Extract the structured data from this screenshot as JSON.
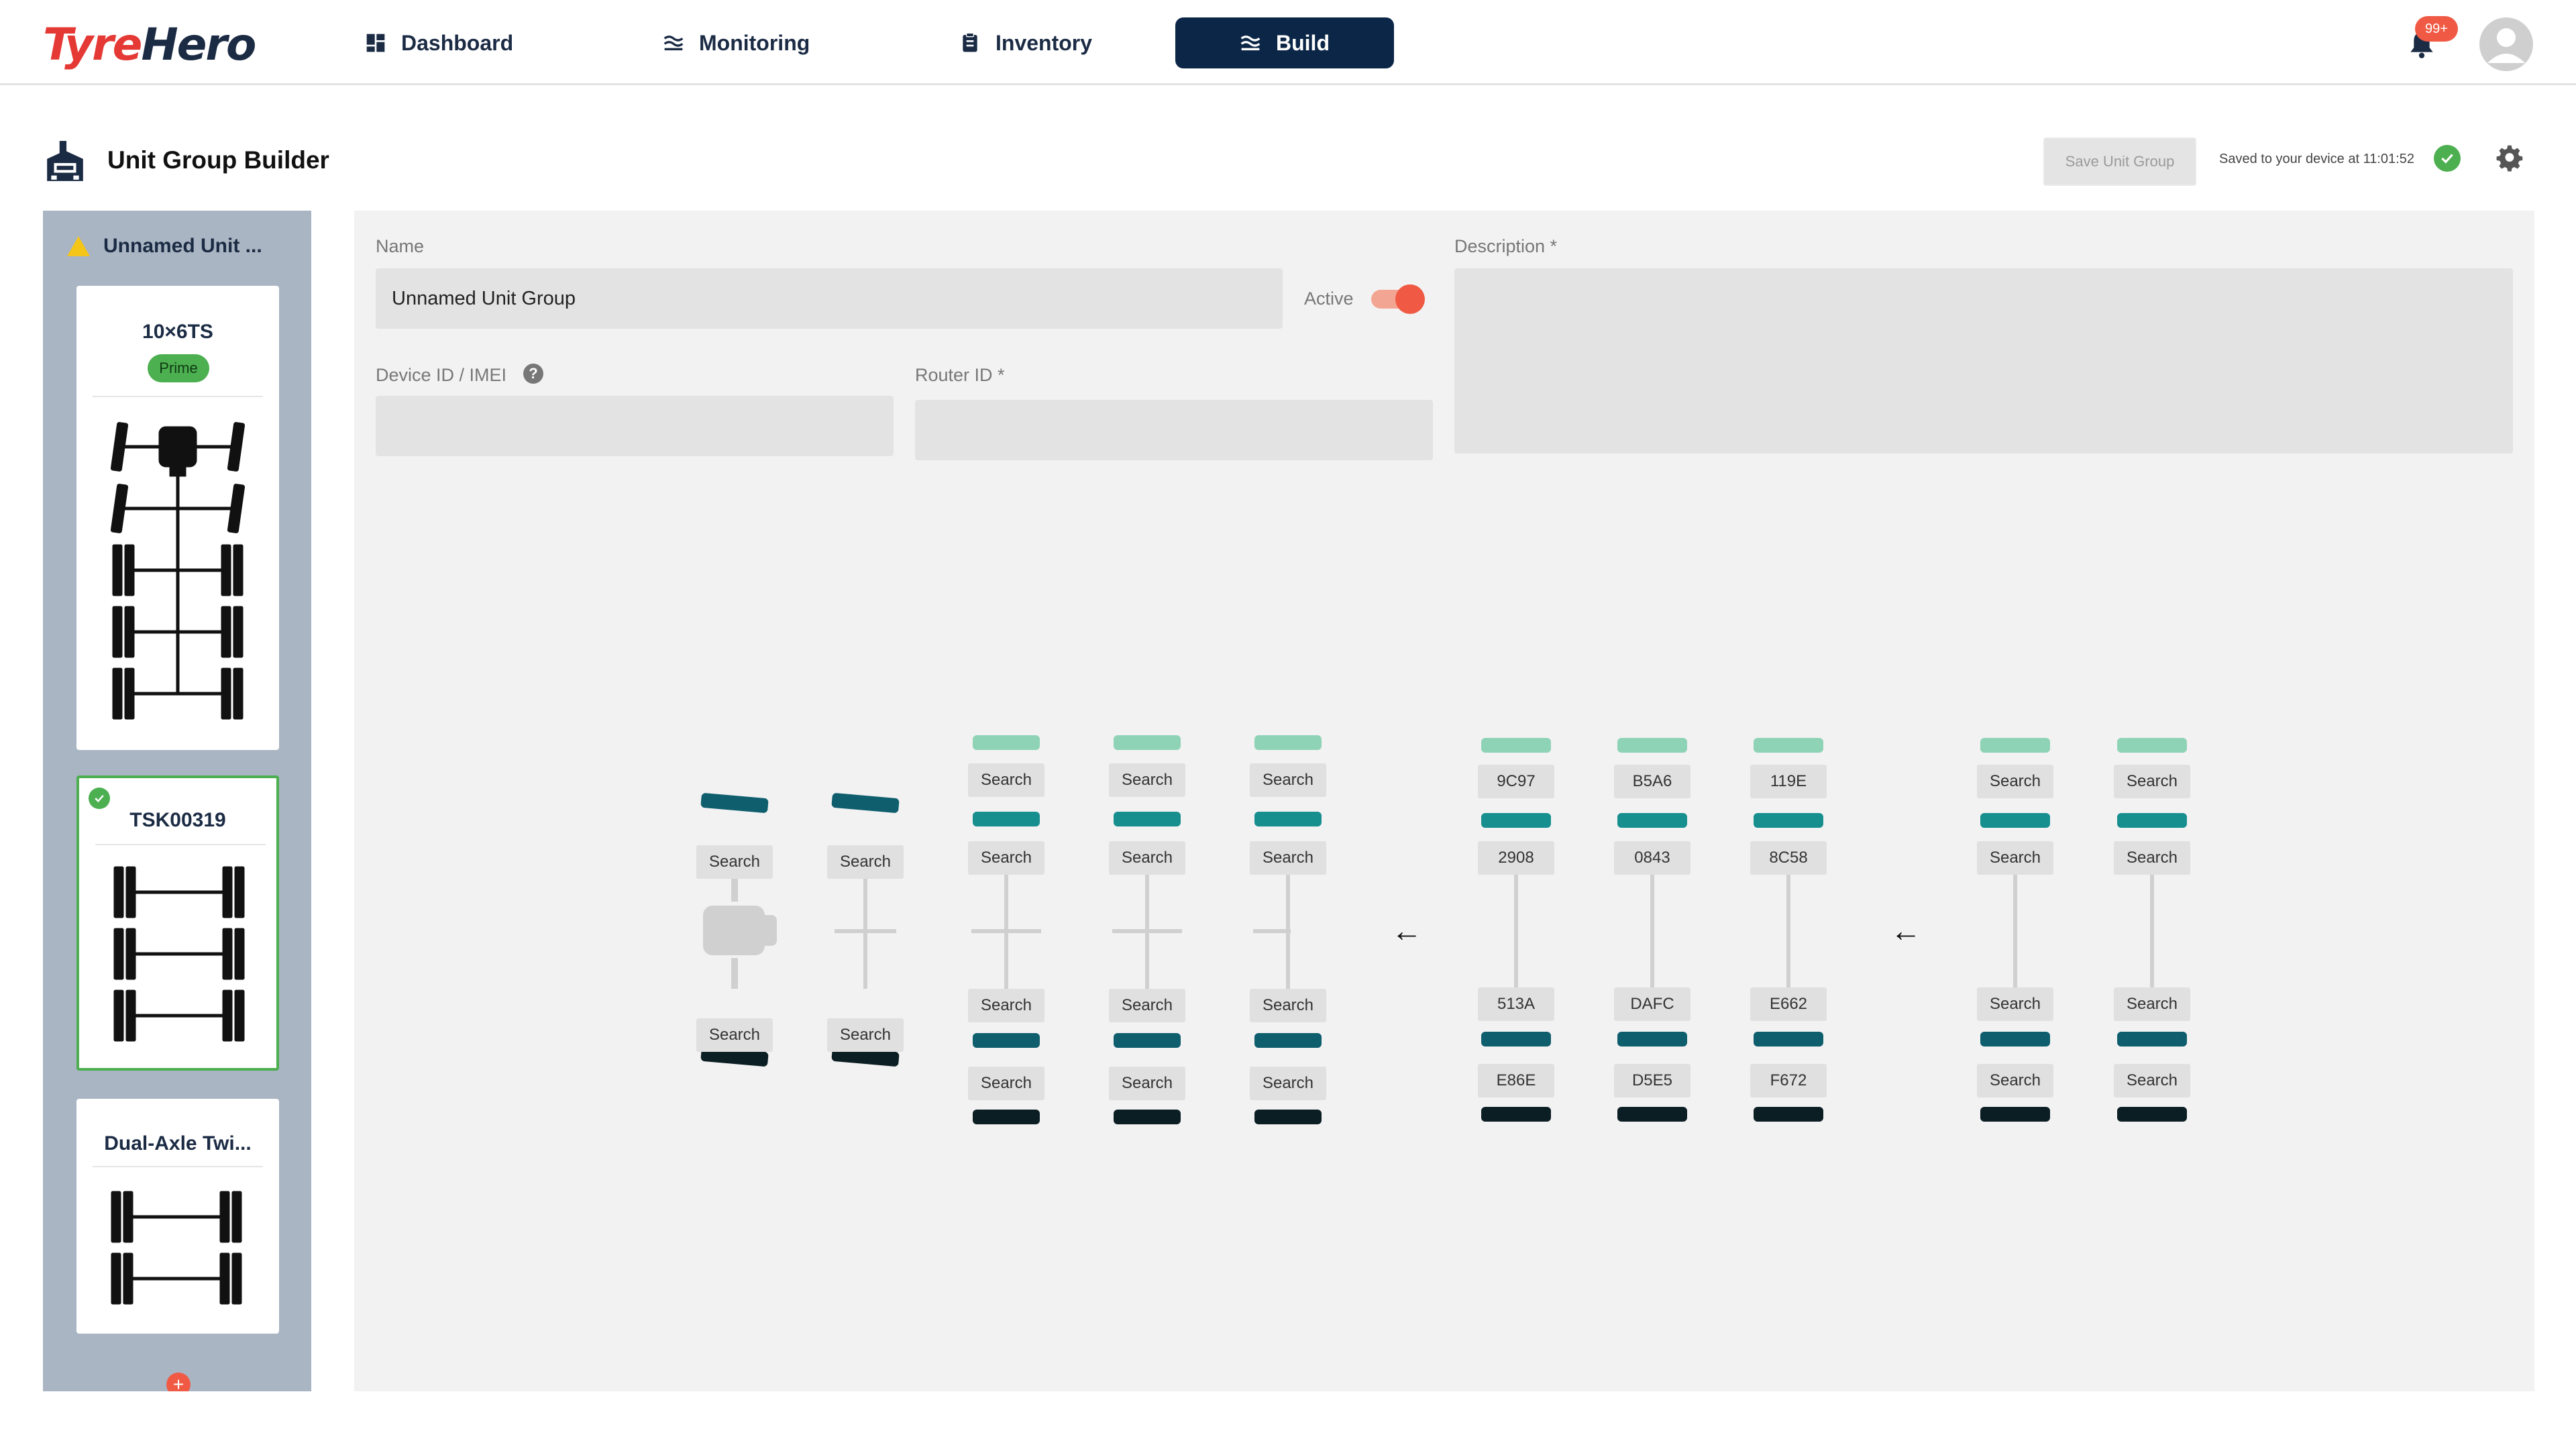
{
  "brand": {
    "logo_part1": "Tyre",
    "logo_part2": "Hero"
  },
  "nav": {
    "dashboard": "Dashboard",
    "monitoring": "Monitoring",
    "inventory": "Inventory",
    "build": "Build",
    "notifications_badge": "99+"
  },
  "header": {
    "title": "Unit Group Builder",
    "save_button": "Save Unit Group",
    "saved_status": "Saved to your device at 11:01:52"
  },
  "sidebar": {
    "group_name": "Unnamed Unit ...",
    "cards": [
      {
        "title": "10×6TS",
        "badge": "Prime"
      },
      {
        "title": "TSK00319"
      },
      {
        "title": "Dual-Axle Twi..."
      }
    ],
    "add_label": "+"
  },
  "form": {
    "name_label": "Name",
    "name_value": "Unnamed Unit Group",
    "active_label": "Active",
    "active_value": true,
    "description_label": "Description *",
    "device_label": "Device ID / IMEI",
    "router_label": "Router ID *",
    "help_icon": "?"
  },
  "diagram": {
    "search_label": "Search",
    "unit1_columns": [
      {
        "top_outer": "Search",
        "top_inner": "Search",
        "bottom_inner": "Search",
        "bottom_outer": "Search"
      },
      {
        "top_outer": "Search",
        "top_inner": "Search",
        "bottom_inner": "Search",
        "bottom_outer": "Search"
      },
      {
        "top_outer": "Search",
        "top_inner": "Search",
        "bottom_inner": "Search",
        "bottom_outer": "Search"
      }
    ],
    "unit2_columns": [
      {
        "top_outer": "9C97",
        "top_inner": "2908",
        "bottom_inner": "513A",
        "bottom_outer": "E86E"
      },
      {
        "top_outer": "B5A6",
        "top_inner": "0843",
        "bottom_inner": "DAFC",
        "bottom_outer": "D5E5"
      },
      {
        "top_outer": "119E",
        "top_inner": "8C58",
        "bottom_inner": "E662",
        "bottom_outer": "F672"
      }
    ],
    "unit3_columns": [
      {
        "top_outer": "Search",
        "top_inner": "Search",
        "bottom_inner": "Search",
        "bottom_outer": "Search"
      },
      {
        "top_outer": "Search",
        "top_inner": "Search",
        "bottom_inner": "Search",
        "bottom_outer": "Search"
      }
    ],
    "arrow": "←",
    "colors": {
      "outer_top": "#8fd3b6",
      "inner": "#178f8f",
      "inner_dark": "#0e5e6e",
      "outer_bottom": "#0b1e24",
      "axle": "#d0d0d0"
    }
  },
  "icons": [
    "dashboard-icon",
    "monitoring-icon",
    "inventory-icon",
    "build-icon",
    "bell-icon",
    "avatar-icon",
    "factory-icon",
    "check-icon",
    "gear-icon",
    "warning-icon",
    "help-icon"
  ]
}
